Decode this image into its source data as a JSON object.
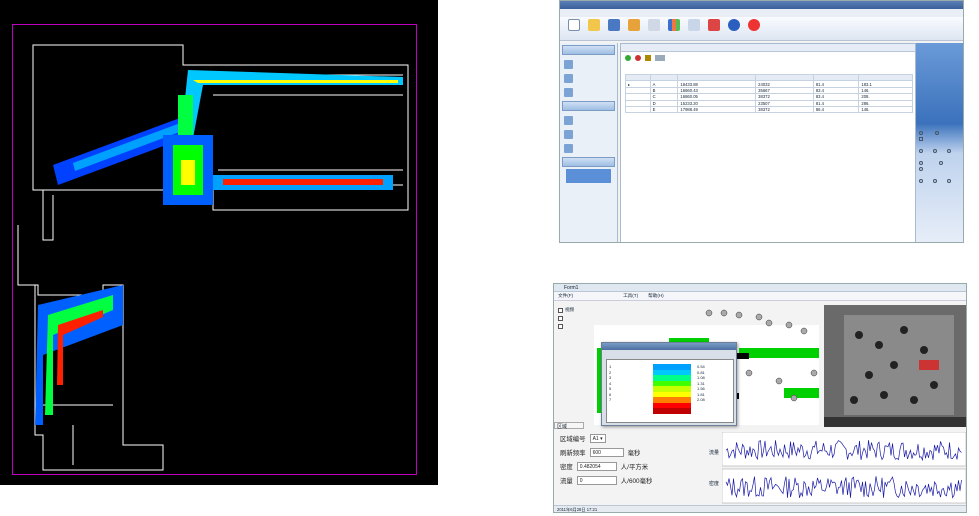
{
  "left_map": {
    "frame_color": "#c000c0",
    "heat_colors": [
      "#0000ff",
      "#00a0ff",
      "#00ff00",
      "#ffff00",
      "#ff0000"
    ]
  },
  "shot1": {
    "title": "",
    "menu": [
      "",
      "",
      "",
      "",
      "",
      "",
      ""
    ],
    "toolbar": [
      "",
      "",
      "",
      "",
      "",
      "",
      "",
      "",
      "",
      ""
    ],
    "nav_groups": [
      {
        "label": "",
        "items": [
          "",
          "",
          ""
        ]
      },
      {
        "label": "",
        "items": [
          "",
          "",
          ""
        ]
      },
      {
        "label": "",
        "items": [
          ""
        ]
      }
    ],
    "grid_rows": [
      {
        "id": "A",
        "v1": "18433.88",
        "v2": "24032",
        "v3": "81.4",
        "v4": "183.1"
      },
      {
        "id": "B",
        "v1": "16660.43",
        "v2": "35667",
        "v3": "83.4",
        "v4": "146."
      },
      {
        "id": "C",
        "v1": "16860.05",
        "v2": "38372",
        "v3": "83.4",
        "v4": "208."
      },
      {
        "id": "D",
        "v1": "15233.20",
        "v2": "23507",
        "v3": "81.4",
        "v4": "286."
      },
      {
        "id": "E",
        "v1": "17988.49",
        "v2": "38372",
        "v3": "86.4",
        "v4": "146."
      }
    ]
  },
  "shot2": {
    "title": "Form1",
    "menu": [
      "文件(F)",
      "",
      "",
      "",
      "",
      "工具(T)",
      "帮助(H)"
    ],
    "checks": [
      "视频",
      "",
      ""
    ],
    "dialog": {
      "title": "",
      "levels": [
        "1",
        "2",
        "3",
        "4",
        "5",
        "6",
        "7"
      ],
      "values": [
        "0.54",
        "0.81",
        "1.08",
        "1.31",
        "1.56",
        "1.81",
        "2.08"
      ],
      "swatches": [
        "#00a0ff",
        "#00c8ff",
        "#00ff88",
        "#40ff00",
        "#c8ff00",
        "#ffff00",
        "#ff8000",
        "#ff0000",
        "#c00000"
      ]
    },
    "tab": "区域",
    "form": {
      "area_label": "区域编号",
      "area_value": "A1",
      "refresh_label": "刷新频率",
      "refresh_value": "600",
      "refresh_unit": "毫秒",
      "density_label": "密度",
      "density_value": "0.482054",
      "density_unit": "人/平方米",
      "flow_label": "流量",
      "flow_value": "0",
      "flow_unit": "人/600毫秒"
    },
    "chart_labels": [
      "流量",
      "密度"
    ],
    "video_caption": "",
    "status": "2011年6月28日   17:21"
  }
}
